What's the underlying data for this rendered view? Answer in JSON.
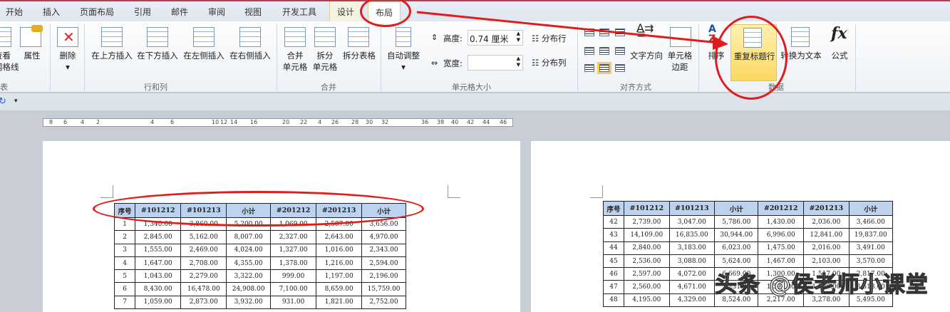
{
  "tabs": [
    "开始",
    "插入",
    "页面布局",
    "引用",
    "邮件",
    "审阅",
    "视图",
    "开发工具",
    "设计",
    "布局"
  ],
  "ribbon": {
    "table_group": {
      "view_gridlines": "查看\n网格线",
      "view_partial": "看",
      "gridlines_partial": "格线",
      "properties": "属性",
      "label_partial": "表"
    },
    "rows_cols": {
      "delete": "删除",
      "insert_above": "在上方插入",
      "insert_below": "在下方插入",
      "insert_left": "在左侧插入",
      "insert_right": "在右侧插入",
      "label": "行和列"
    },
    "merge": {
      "merge_cells_1": "合并",
      "merge_cells_2": "单元格",
      "split_cells_1": "拆分",
      "split_cells_2": "单元格",
      "split_table": "拆分表格",
      "label": "合并"
    },
    "cell_size": {
      "autofit": "自动调整",
      "height_label": "高度:",
      "height_value": "0.74 厘米",
      "width_label": "宽度:",
      "width_value": "",
      "distribute_rows": "分布行",
      "distribute_cols": "分布列",
      "label": "单元格大小"
    },
    "alignment": {
      "text_direction": "文字方向",
      "cell_margins_1": "单元格",
      "cell_margins_2": "边距",
      "label": "对齐方式"
    },
    "data": {
      "sort": "排序",
      "repeat_header": "重复标题行",
      "convert_to_text": "转换为文本",
      "formula": "公式",
      "label": "数据"
    }
  },
  "ruler": [
    "8",
    "6",
    "4",
    "2",
    "4",
    "6",
    "10",
    "12",
    "14",
    "16",
    "20",
    "22",
    "4",
    "26",
    "28",
    "30",
    "32",
    "36",
    "38",
    "40",
    "42",
    "44",
    "46"
  ],
  "headers": [
    "序号",
    "#101212",
    "#101213",
    "小计",
    "#201212",
    "#201213",
    "小计"
  ],
  "left_rows": [
    [
      "1",
      "1,340.00",
      "3,860.00",
      "5,200.00",
      "1,069.00",
      "2,587.00",
      "3,656.00"
    ],
    [
      "2",
      "2,845.00",
      "5,162.00",
      "8,007.00",
      "2,327.00",
      "2,643.00",
      "4,970.00"
    ],
    [
      "3",
      "1,555.00",
      "2,469.00",
      "4,024.00",
      "1,327.00",
      "1,016.00",
      "2,343.00"
    ],
    [
      "4",
      "1,647.00",
      "2,708.00",
      "4,355.00",
      "1,378.00",
      "1,216.00",
      "2,594.00"
    ],
    [
      "5",
      "1,043.00",
      "2,279.00",
      "3,322.00",
      "999.00",
      "1,197.00",
      "2,196.00"
    ],
    [
      "6",
      "8,430.00",
      "16,478.00",
      "24,908.00",
      "7,100.00",
      "8,659.00",
      "15,759.00"
    ],
    [
      "7",
      "1,059.00",
      "2,873.00",
      "3,932.00",
      "931.00",
      "1,821.00",
      "2,752.00"
    ]
  ],
  "right_rows": [
    [
      "42",
      "2,739.00",
      "3,047.00",
      "5,786.00",
      "1,430.00",
      "2,036.00",
      "3,466.00"
    ],
    [
      "43",
      "14,109.00",
      "16,835.00",
      "30,944.00",
      "6,996.00",
      "12,841.00",
      "19,837.00"
    ],
    [
      "44",
      "2,840.00",
      "3,183.00",
      "6,023.00",
      "1,475.00",
      "2,016.00",
      "3,491.00"
    ],
    [
      "45",
      "2,536.00",
      "3,088.00",
      "5,624.00",
      "1,467.00",
      "2,103.00",
      "3,570.00"
    ],
    [
      "46",
      "2,597.00",
      "4,072.00",
      "6,669.00",
      "1,300.00",
      "1,517.00",
      "2,817.00"
    ],
    [
      "47",
      "2,560.00",
      "4,671.00",
      "7,231.00",
      "1,592.00",
      "1,926.00",
      "3,518.00"
    ],
    [
      "48",
      "4,195.00",
      "4,329.00",
      "8,524.00",
      "2,217.00",
      "3,278.00",
      "5,495.00"
    ]
  ],
  "watermark": "头条 @侯老师小课堂",
  "colors": {
    "annotation": "#e01d1d",
    "header_fill": "#bcd2ee",
    "highlight": "#fbe38a"
  }
}
